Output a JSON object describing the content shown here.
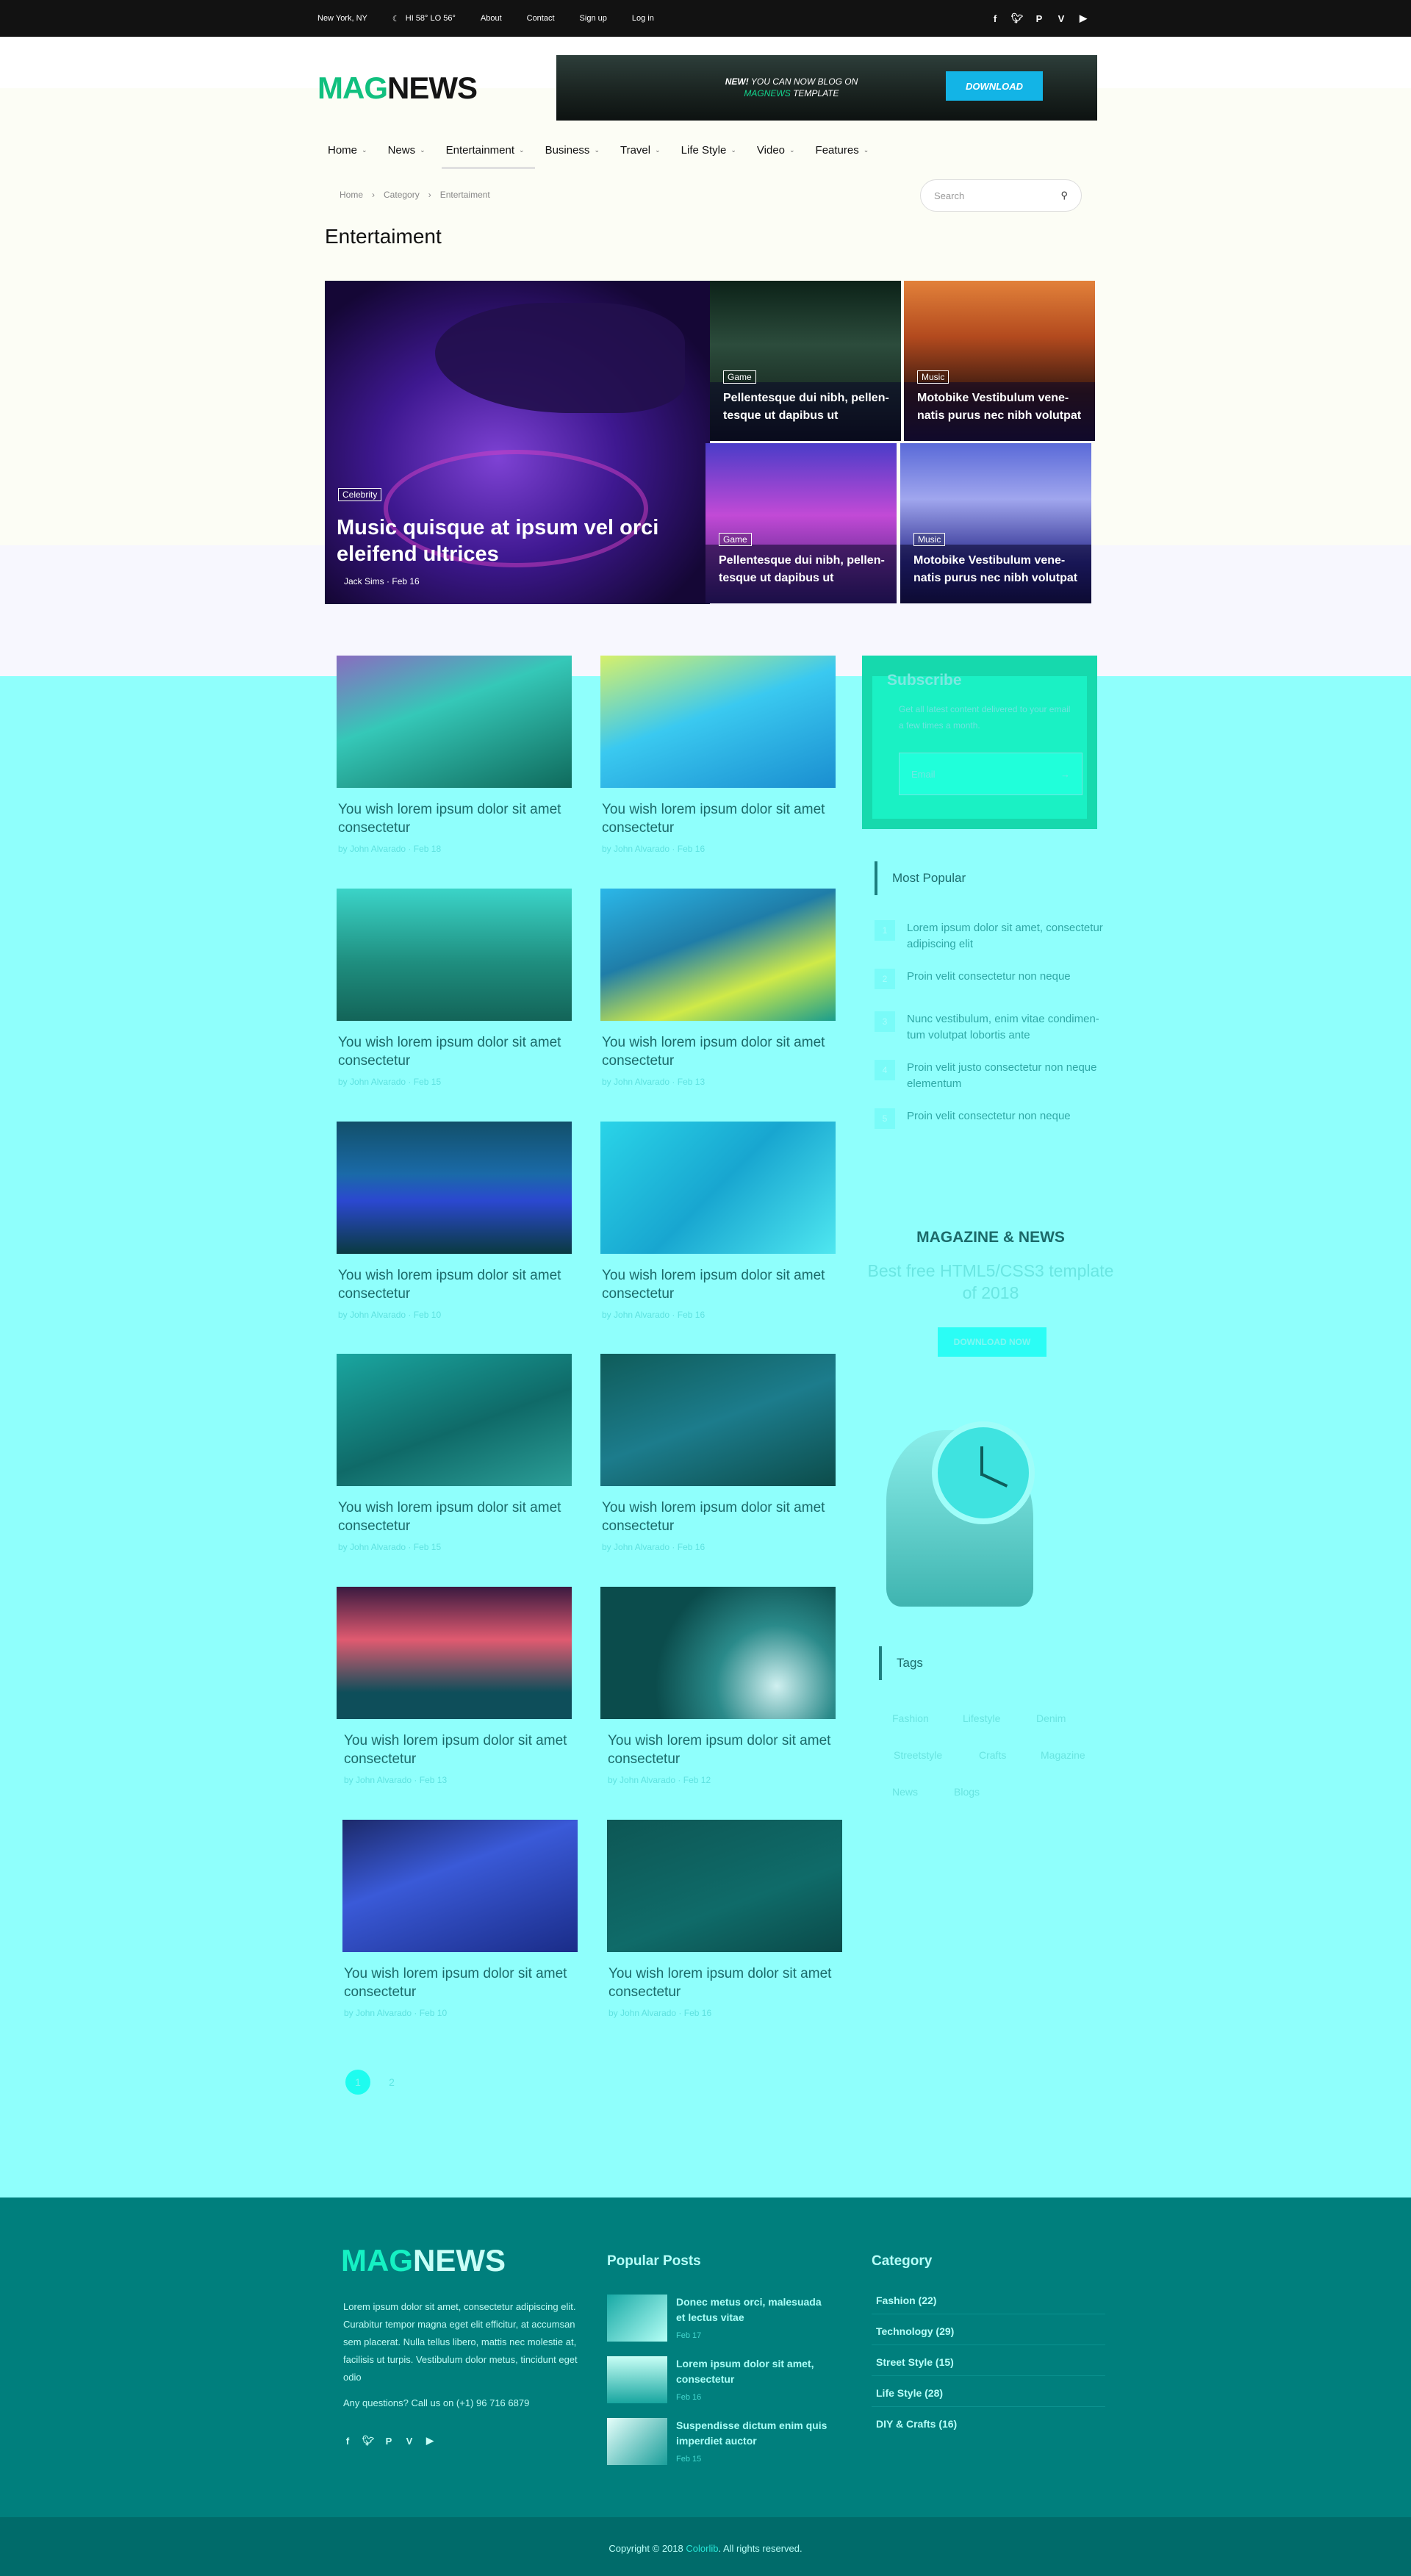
{
  "topbar": {
    "location": "New York, NY",
    "weather": "HI 58° LO 56°",
    "links": [
      "About",
      "Contact",
      "Sign up",
      "Log in"
    ],
    "social_icons": [
      "facebook-icon",
      "twitter-icon",
      "pinterest-icon",
      "vimeo-icon",
      "youtube-icon"
    ]
  },
  "header": {
    "logo_mag": "MAG",
    "logo_news": "NEWS",
    "banner_line1_bold": "NEW!",
    "banner_line1": " YOU CAN NOW BLOG ON",
    "banner_line2_brand": "MAGNEWS",
    "banner_line2": " TEMPLATE",
    "banner_button": "DOWNLOAD"
  },
  "nav": [
    "Home",
    "News",
    "Entertainment",
    "Business",
    "Travel",
    "Life Style",
    "Video",
    "Features"
  ],
  "breadcrumb": [
    "Home",
    "Category",
    "Entertaiment"
  ],
  "search": {
    "placeholder": "Search"
  },
  "page_title": "Entertaiment",
  "hero": {
    "main": {
      "tag": "Celebrity",
      "title": "Music quisque at ipsum vel orci eleifend ultrices",
      "author": "Jack Sims",
      "date": "Feb 16"
    },
    "small": [
      {
        "tag": "Game",
        "title": "Pellentesque dui nibh, pellen-tesque ut dapibus ut"
      },
      {
        "tag": "Music",
        "title": "Motobike Vestibulum vene-natis purus nec nibh volutpat"
      },
      {
        "tag": "Game",
        "title": "Pellentesque dui nibh, pellen-tesque ut dapibus ut"
      },
      {
        "tag": "Music",
        "title": "Motobike Vestibulum vene-natis purus nec nibh volutpat"
      }
    ]
  },
  "articles": [
    {
      "title": "You wish lorem ipsum dolor sit amet consectetur",
      "by": "by",
      "author": "John Alvarado",
      "date": "Feb 18"
    },
    {
      "title": "You wish lorem ipsum dolor sit amet consectetur",
      "by": "by",
      "author": "John Alvarado",
      "date": "Feb 16"
    },
    {
      "title": "You wish lorem ipsum dolor sit amet consectetur",
      "by": "by",
      "author": "John Alvarado",
      "date": "Feb 15"
    },
    {
      "title": "You wish lorem ipsum dolor sit amet consectetur",
      "by": "by",
      "author": "John Alvarado",
      "date": "Feb 13"
    },
    {
      "title": "You wish lorem ipsum dolor sit amet consectetur",
      "by": "by",
      "author": "John Alvarado",
      "date": "Feb 10"
    },
    {
      "title": "You wish lorem ipsum dolor sit amet consectetur",
      "by": "by",
      "author": "John Alvarado",
      "date": "Feb 16"
    },
    {
      "title": "You wish lorem ipsum dolor sit amet consectetur",
      "by": "by",
      "author": "John Alvarado",
      "date": "Feb 15"
    },
    {
      "title": "You wish lorem ipsum dolor sit amet consectetur",
      "by": "by",
      "author": "John Alvarado",
      "date": "Feb 16"
    },
    {
      "title": "You wish lorem ipsum dolor sit amet consectetur",
      "by": "by",
      "author": "John Alvarado",
      "date": "Feb 13"
    },
    {
      "title": "You wish lorem ipsum dolor sit amet consectetur",
      "by": "by",
      "author": "John Alvarado",
      "date": "Feb 12"
    },
    {
      "title": "You wish lorem ipsum dolor sit amet consectetur",
      "by": "by",
      "author": "John Alvarado",
      "date": "Feb 10"
    },
    {
      "title": "You wish lorem ipsum dolor sit amet consectetur",
      "by": "by",
      "author": "John Alvarado",
      "date": "Feb 16"
    }
  ],
  "pagination": [
    "1",
    "2"
  ],
  "subscribe": {
    "title": "Subscribe",
    "desc": "Get all latest content delivered to your email a few times a month.",
    "placeholder": "Email"
  },
  "most_popular": {
    "title": "Most Popular",
    "items": [
      {
        "n": "1",
        "text": "Lorem ipsum dolor sit amet, consectetur adipiscing elit"
      },
      {
        "n": "2",
        "text": "Proin velit consectetur non neque"
      },
      {
        "n": "3",
        "text": "Nunc vestibulum, enim vitae condimen-tum volutpat lobortis ante"
      },
      {
        "n": "4",
        "text": "Proin velit justo consectetur non neque elementum"
      },
      {
        "n": "5",
        "text": "Proin velit consectetur non neque"
      }
    ]
  },
  "promo": {
    "title": "MAGAZINE & NEWS",
    "subtitle": "Best free HTML5/CSS3 template of 2018",
    "button": "DOWNLOAD NOW"
  },
  "tags": {
    "title": "Tags",
    "items": [
      "Fashion",
      "Lifestyle",
      "Denim",
      "Streetstyle",
      "Crafts",
      "Magazine",
      "News",
      "Blogs"
    ]
  },
  "footer": {
    "logo_mag": "MAG",
    "logo_news": "NEWS",
    "about": "Lorem ipsum dolor sit amet, consectetur adipiscing elit. Curabitur tempor magna eget elit efficitur, at accumsan sem placerat. Nulla tellus libero, mattis nec molestie at, facilisis ut turpis. Vestibulum dolor metus, tincidunt eget odio",
    "questions": "Any questions? Call us on (+1) 96 716 6879",
    "popular_title": "Popular Posts",
    "posts": [
      {
        "title": "Donec metus orci, malesuada et lectus vitae",
        "date": "Feb 17"
      },
      {
        "title": "Lorem ipsum dolor sit amet, consectetur",
        "date": "Feb 16"
      },
      {
        "title": "Suspendisse dictum enim quis imperdiet auctor",
        "date": "Feb 15"
      }
    ],
    "category_title": "Category",
    "categories": [
      "Fashion (22)",
      "Technology (29)",
      "Street Style (15)",
      "Life Style (28)",
      "DIY & Crafts (16)"
    ],
    "copyright_pre": "Copyright © 2018 ",
    "copyright_link": "Colorlib",
    "copyright_post": ". All rights reserved."
  }
}
